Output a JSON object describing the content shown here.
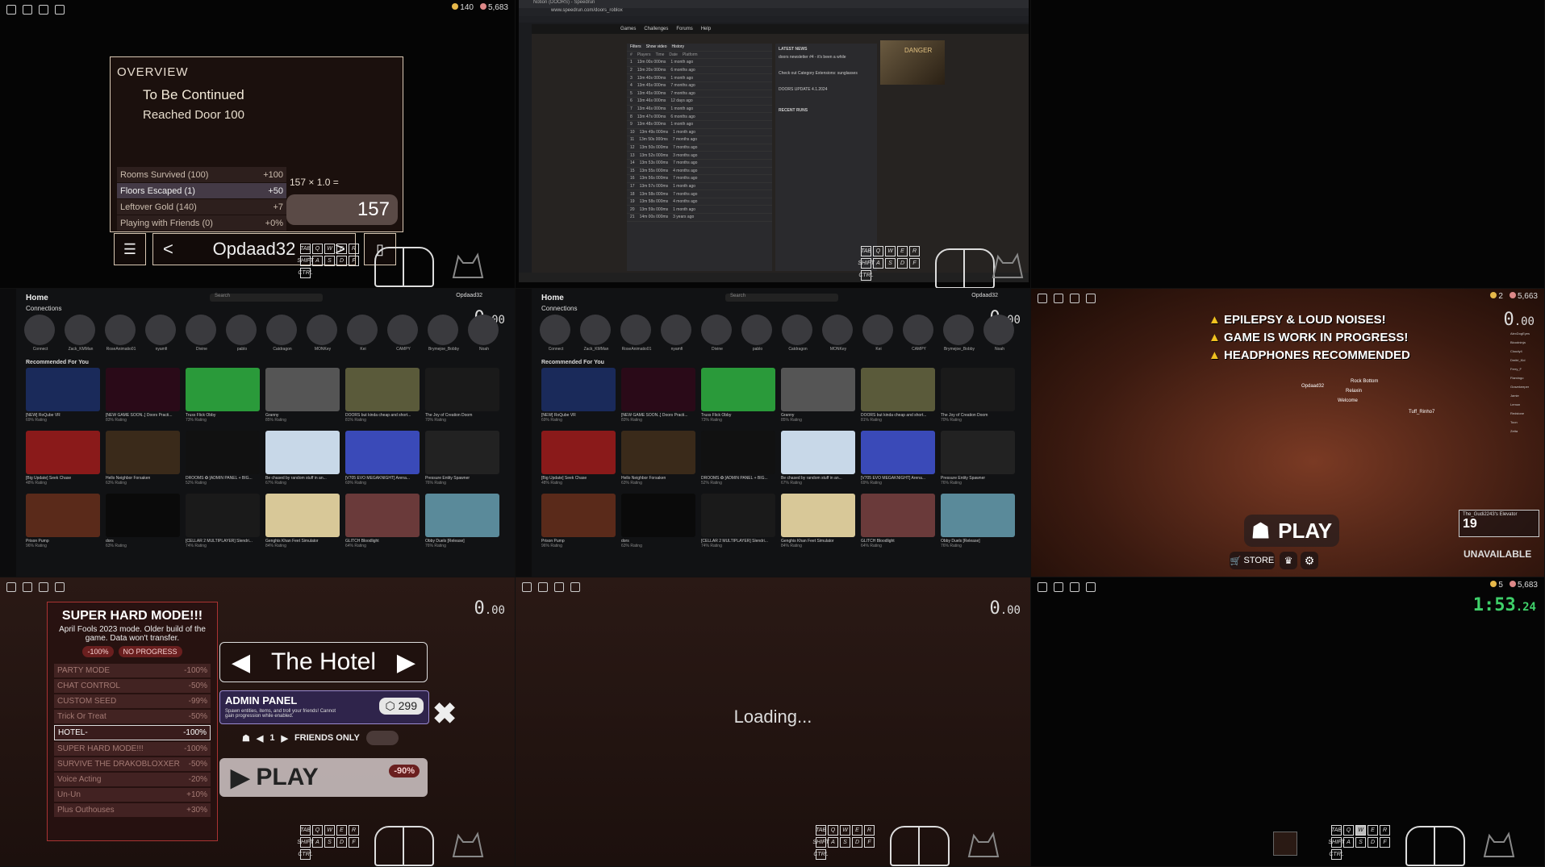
{
  "controls": {
    "keys": [
      "TAB",
      "Q",
      "W",
      "E",
      "R",
      "SHIFT",
      "A",
      "S",
      "D",
      "F",
      "CTRL"
    ]
  },
  "cell1": {
    "currency": {
      "a": "140",
      "b": "5,683"
    },
    "overview": {
      "title": "OVERVIEW",
      "headline": "To Be Continued",
      "subline": "Reached Door 100",
      "rows": [
        {
          "label": "Rooms Survived (100)",
          "value": "+100"
        },
        {
          "label": "Floors Escaped (1)",
          "value": "+50"
        },
        {
          "label": "Leftover Gold (140)",
          "value": "+7"
        },
        {
          "label": "Playing with Friends (0)",
          "value": "+0%"
        }
      ],
      "multiplier": "157 × 1.0 =",
      "total": "157"
    },
    "player_name": "Opdaad32",
    "prev_arrow": "<",
    "next_arrow": ">"
  },
  "cell2": {
    "tab_title": "Notion (DOORS) - Speedrun",
    "url": "www.speedrun.com/doors_roblox",
    "nav": [
      "Games",
      "Challenges",
      "Forums",
      "Help"
    ],
    "filters": "Filters",
    "show_video": "Show video",
    "history": "History",
    "leaderboard_header": [
      "#",
      "Players",
      "Time",
      "Date",
      "Platform"
    ],
    "rows": [
      {
        "rank": "1",
        "time": "13m 00s 000ms",
        "date": "1 month ago"
      },
      {
        "rank": "2",
        "time": "13m 20s 000ms",
        "date": "6 months ago"
      },
      {
        "rank": "3",
        "time": "13m 40s 000ms",
        "date": "1 month ago"
      },
      {
        "rank": "4",
        "time": "13m 45s 000ms",
        "date": "7 months ago"
      },
      {
        "rank": "5",
        "time": "13m 45s 000ms",
        "date": "7 months ago"
      },
      {
        "rank": "6",
        "time": "13m 46s 000ms",
        "date": "12 days ago"
      },
      {
        "rank": "7",
        "time": "13m 46s 000ms",
        "date": "1 month ago"
      },
      {
        "rank": "8",
        "time": "13m 47s 000ms",
        "date": "6 months ago"
      },
      {
        "rank": "9",
        "time": "13m 48s 000ms",
        "date": "1 month ago"
      },
      {
        "rank": "10",
        "time": "13m 49s 000ms",
        "date": "1 month ago"
      },
      {
        "rank": "11",
        "time": "13m 50s 000ms",
        "date": "7 months ago"
      },
      {
        "rank": "12",
        "time": "13m 50s 000ms",
        "date": "7 months ago"
      },
      {
        "rank": "13",
        "time": "13m 52s 000ms",
        "date": "3 months ago"
      },
      {
        "rank": "14",
        "time": "13m 53s 000ms",
        "date": "7 months ago"
      },
      {
        "rank": "15",
        "time": "13m 55s 000ms",
        "date": "4 months ago"
      },
      {
        "rank": "16",
        "time": "13m 56s 000ms",
        "date": "7 months ago"
      },
      {
        "rank": "17",
        "time": "13m 57s 000ms",
        "date": "1 month ago"
      },
      {
        "rank": "18",
        "time": "13m 58s 000ms",
        "date": "7 months ago"
      },
      {
        "rank": "19",
        "time": "13m 58s 000ms",
        "date": "4 months ago"
      },
      {
        "rank": "20",
        "time": "13m 59s 000ms",
        "date": "1 month ago"
      },
      {
        "rank": "21",
        "time": "14m 00s 000ms",
        "date": "3 years ago"
      }
    ],
    "news_title": "LATEST NEWS",
    "news_items": [
      "doors newsletter #4 - it's been a while",
      "Check out Category Extensions: sunglasses",
      "DOORS UPDATE 4.1.2024"
    ],
    "recent_runs": "RECENT RUNS",
    "poster": "DANGER"
  },
  "home": {
    "title": "Home",
    "search": "Search",
    "user": "Opdaad32",
    "connections": "Connections",
    "recommended": "Recommended For You",
    "timer": "0",
    "timer_dec": ".00",
    "friends": [
      "Connect",
      "Zack_KMMan",
      "RoseAnimatio01",
      "nyamfi",
      "Divine",
      "pablo",
      "Catdragon",
      "MONKey",
      "Kei",
      "CAMPY",
      "Brymejoe_Bobby",
      "Noah"
    ],
    "games": [
      {
        "name": "[NEW] RoQube VR",
        "rating": "69% Rating",
        "color": "#1a2a5a"
      },
      {
        "name": "[NEW GAME SOON..] Doors Practi...",
        "rating": "83% Rating",
        "color": "#2a0a18"
      },
      {
        "name": "Truss Flick Obby",
        "rating": "73% Rating",
        "color": "#2a9a3a"
      },
      {
        "name": "Granny",
        "rating": "85% Rating",
        "color": "#555"
      },
      {
        "name": "DOORS but kinda cheap and short...",
        "rating": "81% Rating",
        "color": "#5a5a3a"
      },
      {
        "name": "The Joy of Creation Doom",
        "rating": "70% Rating",
        "color": "#1a1a1a"
      },
      {
        "name": "[Big Update] Seek Chase",
        "rating": "48% Rating",
        "color": "#8a1a1a"
      },
      {
        "name": "Hello Neighbor Forsaken",
        "rating": "63% Rating",
        "color": "#3a2a1a"
      },
      {
        "name": "DROOMS ✪ [ADMIN PANEL + BIG...",
        "rating": "52% Rating",
        "color": "#111"
      },
      {
        "name": "Be chased by random stuff in an...",
        "rating": "67% Rating",
        "color": "#c8d8e8"
      },
      {
        "name": "[V705 EVO MEGAKNIGHT] Arena...",
        "rating": "69% Rating",
        "color": "#3a4ab8"
      },
      {
        "name": "Pressure Entity Spawner",
        "rating": "76% Rating",
        "color": "#222"
      },
      {
        "name": "Prison Pump",
        "rating": "96% Rating",
        "color": "#5a2a1a"
      },
      {
        "name": "dors",
        "rating": "63% Rating",
        "color": "#0a0a0a"
      },
      {
        "name": "[CELLAR 2 MULTIPLAYER] Slendri...",
        "rating": "74% Rating",
        "color": "#1a1a1a"
      },
      {
        "name": "Genghis Khan Feet Simulator",
        "rating": "84% Rating",
        "color": "#d8c898"
      },
      {
        "name": "GLITCH Bloodlight",
        "rating": "64% Rating",
        "color": "#6a3a3a"
      },
      {
        "name": "Obby Duels [Release]",
        "rating": "76% Rating",
        "color": "#5a8a9a"
      }
    ]
  },
  "lobby": {
    "currency": {
      "a": "2",
      "b": "5,663"
    },
    "timer": "0",
    "timer_dec": ".00",
    "warnings": [
      "EPILEPSY & LOUD NOISES!",
      "GAME IS WORK IN PROGRESS!",
      "HEADPHONES RECOMMENDED"
    ],
    "play": "PLAY",
    "store": "STORE",
    "elevator_title": "The_Gudi2243's Elevator",
    "elevator_count": "19",
    "unavailable": "UNAVAILABLE",
    "names": [
      "Opdaad32",
      "Tuff_Rinho7",
      "Rock Bottom",
      "Welcome",
      "Relaxin"
    ],
    "player_list": [
      "AlexDogEyes",
      "Bloodninja",
      "Cloudy4",
      "Dmitri_Kid",
      "Ferry_F",
      "Flamingo",
      "Gravekeeper",
      "Jamie",
      "Lemon",
      "Redstone",
      "Toon",
      "Zetta"
    ]
  },
  "hardmode": {
    "timer": "0",
    "timer_dec": ".00",
    "title": "SUPER HARD MODE!!!",
    "desc": "April Fools 2023 mode. Older build of the game. Data won't transfer.",
    "badge1": "-100%",
    "badge2": "NO PROGRESS",
    "modifiers": [
      {
        "label": "PARTY MODE",
        "value": "-100%"
      },
      {
        "label": "CHAT CONTROL",
        "value": "-50%"
      },
      {
        "label": "CUSTOM SEED",
        "value": "-99%"
      },
      {
        "label": "Trick Or Treat",
        "value": "-50%"
      },
      {
        "label": "HOTEL-",
        "value": "-100%"
      },
      {
        "label": "SUPER HARD MODE!!!",
        "value": "-100%"
      },
      {
        "label": "SURVIVE THE DRAKOBLOXXER",
        "value": "-50%"
      },
      {
        "label": "Voice Acting",
        "value": "-20%"
      },
      {
        "label": "Un-Un",
        "value": "+10%"
      },
      {
        "label": "Plus Outhouses",
        "value": "+30%"
      }
    ],
    "floor": "The Hotel",
    "admin_title": "ADMIN PANEL",
    "admin_desc": "Spawn entities, items, and troll your friends! Cannot gain progression while enabled.",
    "admin_price": "299",
    "close": "✖",
    "friend_count": "1",
    "friends_only": "FRIENDS ONLY",
    "play": "PLAY",
    "play_cost": "-90%"
  },
  "loading": {
    "timer": "0",
    "timer_dec": ".00",
    "text": "Loading..."
  },
  "dark": {
    "currency": {
      "a": "5",
      "b": "5,683"
    },
    "timer": "1:53",
    "timer_dec": ".24"
  }
}
